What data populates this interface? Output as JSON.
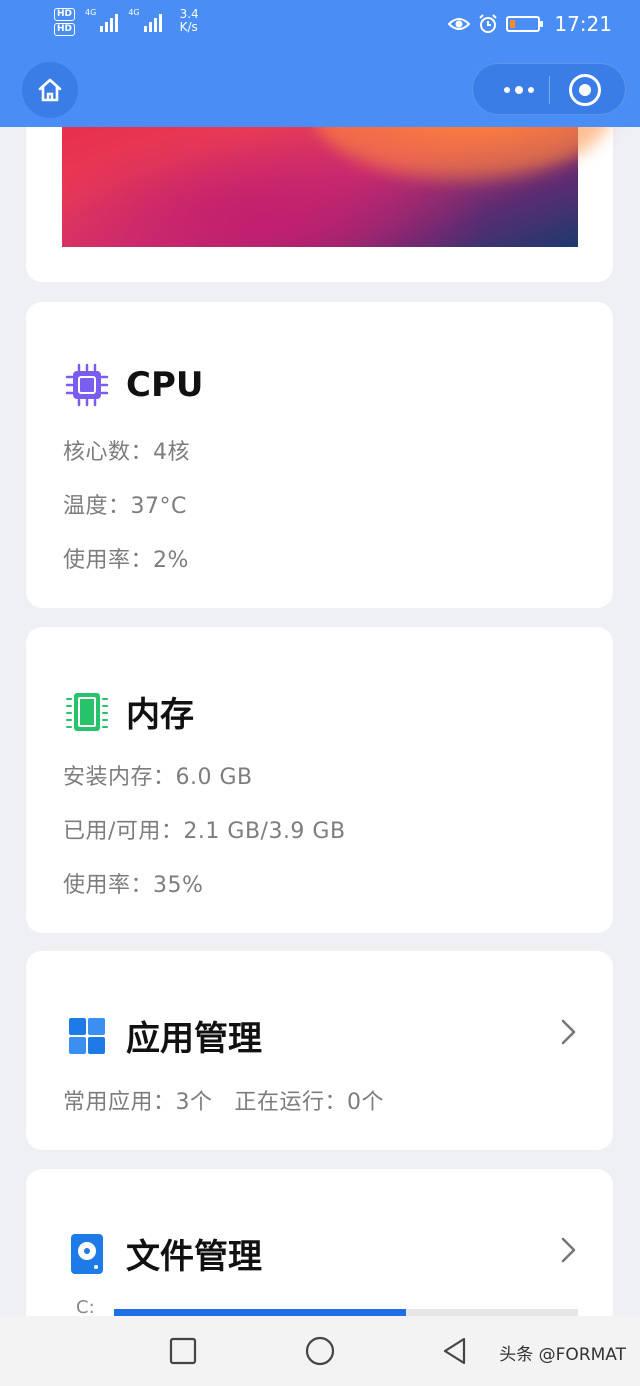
{
  "status_bar": {
    "hd1": "HD",
    "hd2": "HD",
    "net1": "4G",
    "net2": "4G",
    "speed_value": "3.4",
    "speed_unit": "K/s",
    "time": "17:21"
  },
  "header": {
    "home_icon": "home-icon",
    "more_icon": "more-dots-icon",
    "close_icon": "target-close-icon",
    "bg_color": "#4a8ef5"
  },
  "cpu": {
    "title": "CPU",
    "cores": "核心数：4核",
    "temp": "温度：37°C",
    "usage": "使用率：2%",
    "icon": "cpu-chip-icon",
    "icon_color": "#7b5cf0"
  },
  "memory": {
    "title": "内存",
    "installed": "安装内存：6.0 GB",
    "used_available": "已用/可用：2.1 GB/3.9 GB",
    "usage": "使用率：35%",
    "icon": "memory-icon",
    "icon_color": "#27c26a"
  },
  "apps": {
    "title": "应用管理",
    "common": "常用应用：3个",
    "running": "正在运行：0个",
    "icon": "windows-grid-icon",
    "icon_color": "#1e7ae6"
  },
  "files": {
    "title": "文件管理",
    "disk_label": "C:",
    "disk_usage_fraction": 0.63,
    "icon": "disk-icon",
    "icon_color": "#1e7ae6"
  },
  "nav": {
    "recent_icon": "square-icon",
    "home_icon": "circle-icon",
    "back_icon": "triangle-back-icon"
  },
  "watermark": "头条 @FORMAT"
}
